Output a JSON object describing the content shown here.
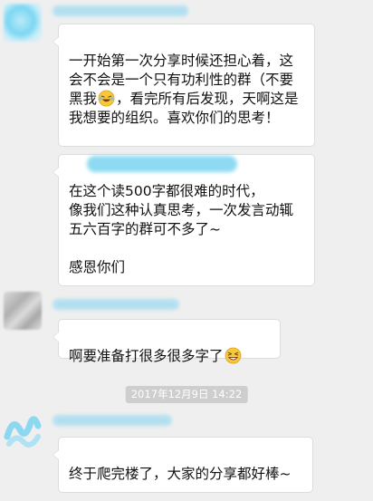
{
  "messages": [
    {
      "sender_name": "",
      "lines": [
        "一开始第一次分享时候还担心着，这会不会是一个只有功利性的群（不要黑我",
        "，看完所有后发现，天啊这是我想要的组织。喜欢你们的思考！"
      ],
      "emoji": "laughing-tears-emoji"
    },
    {
      "para1": "…时代，",
      "para2": "在这个读500字都很难的时代，\n像我们这种认真思考，一次发言动辄五六百字的群可不多了~",
      "para3": "感恩你们"
    },
    {
      "text": "啊要准备打很多很多字了",
      "emoji": "grin-sweat-emoji"
    },
    {
      "text": "终于爬完楼了，大家的分享都好棒~"
    }
  ],
  "timestamp": "2017年12月9日 14:22",
  "colors": {
    "background": "#efefef",
    "bubble": "#ffffff",
    "redaction": "#7ad4f0",
    "timestamp_bg": "#cecece"
  }
}
